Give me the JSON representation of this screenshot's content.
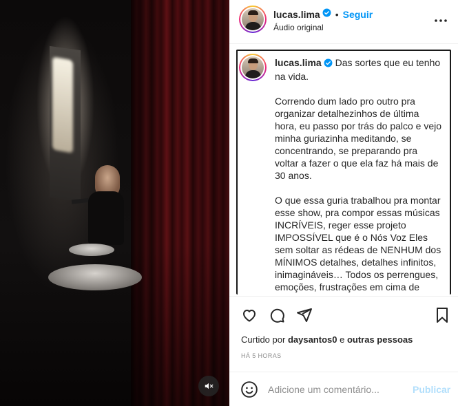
{
  "post": {
    "username": "lucas.lima",
    "separator": "•",
    "follow_label": "Seguir",
    "audio_label": "Áudio original"
  },
  "caption": {
    "username": "lucas.lima",
    "paragraphs": [
      "Das sortes que eu tenho na vida.",
      "Correndo dum lado pro outro pra organizar detalhezinhos de última hora, eu passo por trás do palco e vejo minha guriazinha meditando, se concentrando, se preparando pra voltar a fazer o que ela faz há mais de 30 anos.",
      "O que essa guria trabalhou pra montar esse show, pra compor essas músicas INCRÍVEIS, reger esse projeto IMPOSSÍVEL que é o Nós Voz Eles sem soltar as rédeas de NENHUM dos MÍNIMOS detalhes, detalhes infinitos, inimagináveis… Todos os perrengues, emoções, frustrações em cima de"
    ]
  },
  "likes": {
    "prefix": "Curtido por",
    "user": "daysantos0",
    "connector": "e",
    "others": "outras pessoas"
  },
  "timestamp": "HÁ 5 HORAS",
  "comment": {
    "placeholder": "Adicione um comentário...",
    "publish_label": "Publicar"
  },
  "icons": {
    "verified": "verified-badge-icon",
    "more": "more-options-icon",
    "like": "heart-icon",
    "comment": "comment-bubble-icon",
    "share": "paper-plane-icon",
    "save": "bookmark-icon",
    "emoji": "emoji-smile-icon",
    "mute": "muted-speaker-icon"
  },
  "colors": {
    "accent": "#0095f6",
    "publish_disabled": "#b2dffc",
    "text": "#262626",
    "muted": "#8e8e8e"
  }
}
